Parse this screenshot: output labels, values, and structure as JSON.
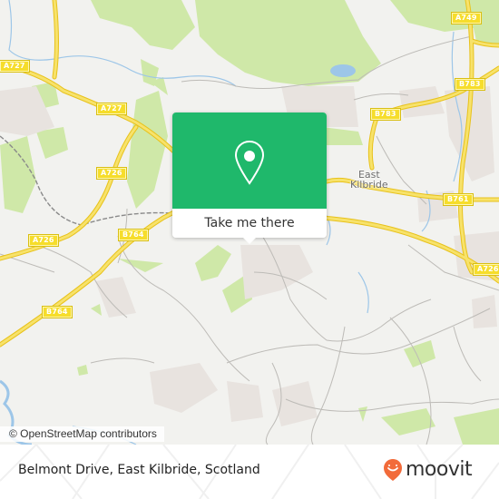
{
  "map": {
    "road_labels": [
      {
        "id": "a727-left",
        "text": "A727"
      },
      {
        "id": "a727-mid",
        "text": "A727"
      },
      {
        "id": "a726-upper",
        "text": "A726"
      },
      {
        "id": "a726-left",
        "text": "A726"
      },
      {
        "id": "b764-upper",
        "text": "B764"
      },
      {
        "id": "b764-lower",
        "text": "B764"
      },
      {
        "id": "a749",
        "text": "A749"
      },
      {
        "id": "b783-right",
        "text": "B783"
      },
      {
        "id": "b783-mid",
        "text": "B783"
      },
      {
        "id": "b761",
        "text": "B761"
      },
      {
        "id": "a726-right",
        "text": "A726"
      }
    ],
    "place_label": {
      "line1": "East",
      "line2": "Kilbride"
    },
    "attribution": "© OpenStreetMap contributors"
  },
  "popup": {
    "icon": "map-pin-icon",
    "button_label": "Take me there",
    "color": "#1fb86b"
  },
  "footer": {
    "address": "Belmont Drive, East Kilbride, Scotland",
    "brand": "moovit",
    "brand_color": "#f26b3a"
  }
}
